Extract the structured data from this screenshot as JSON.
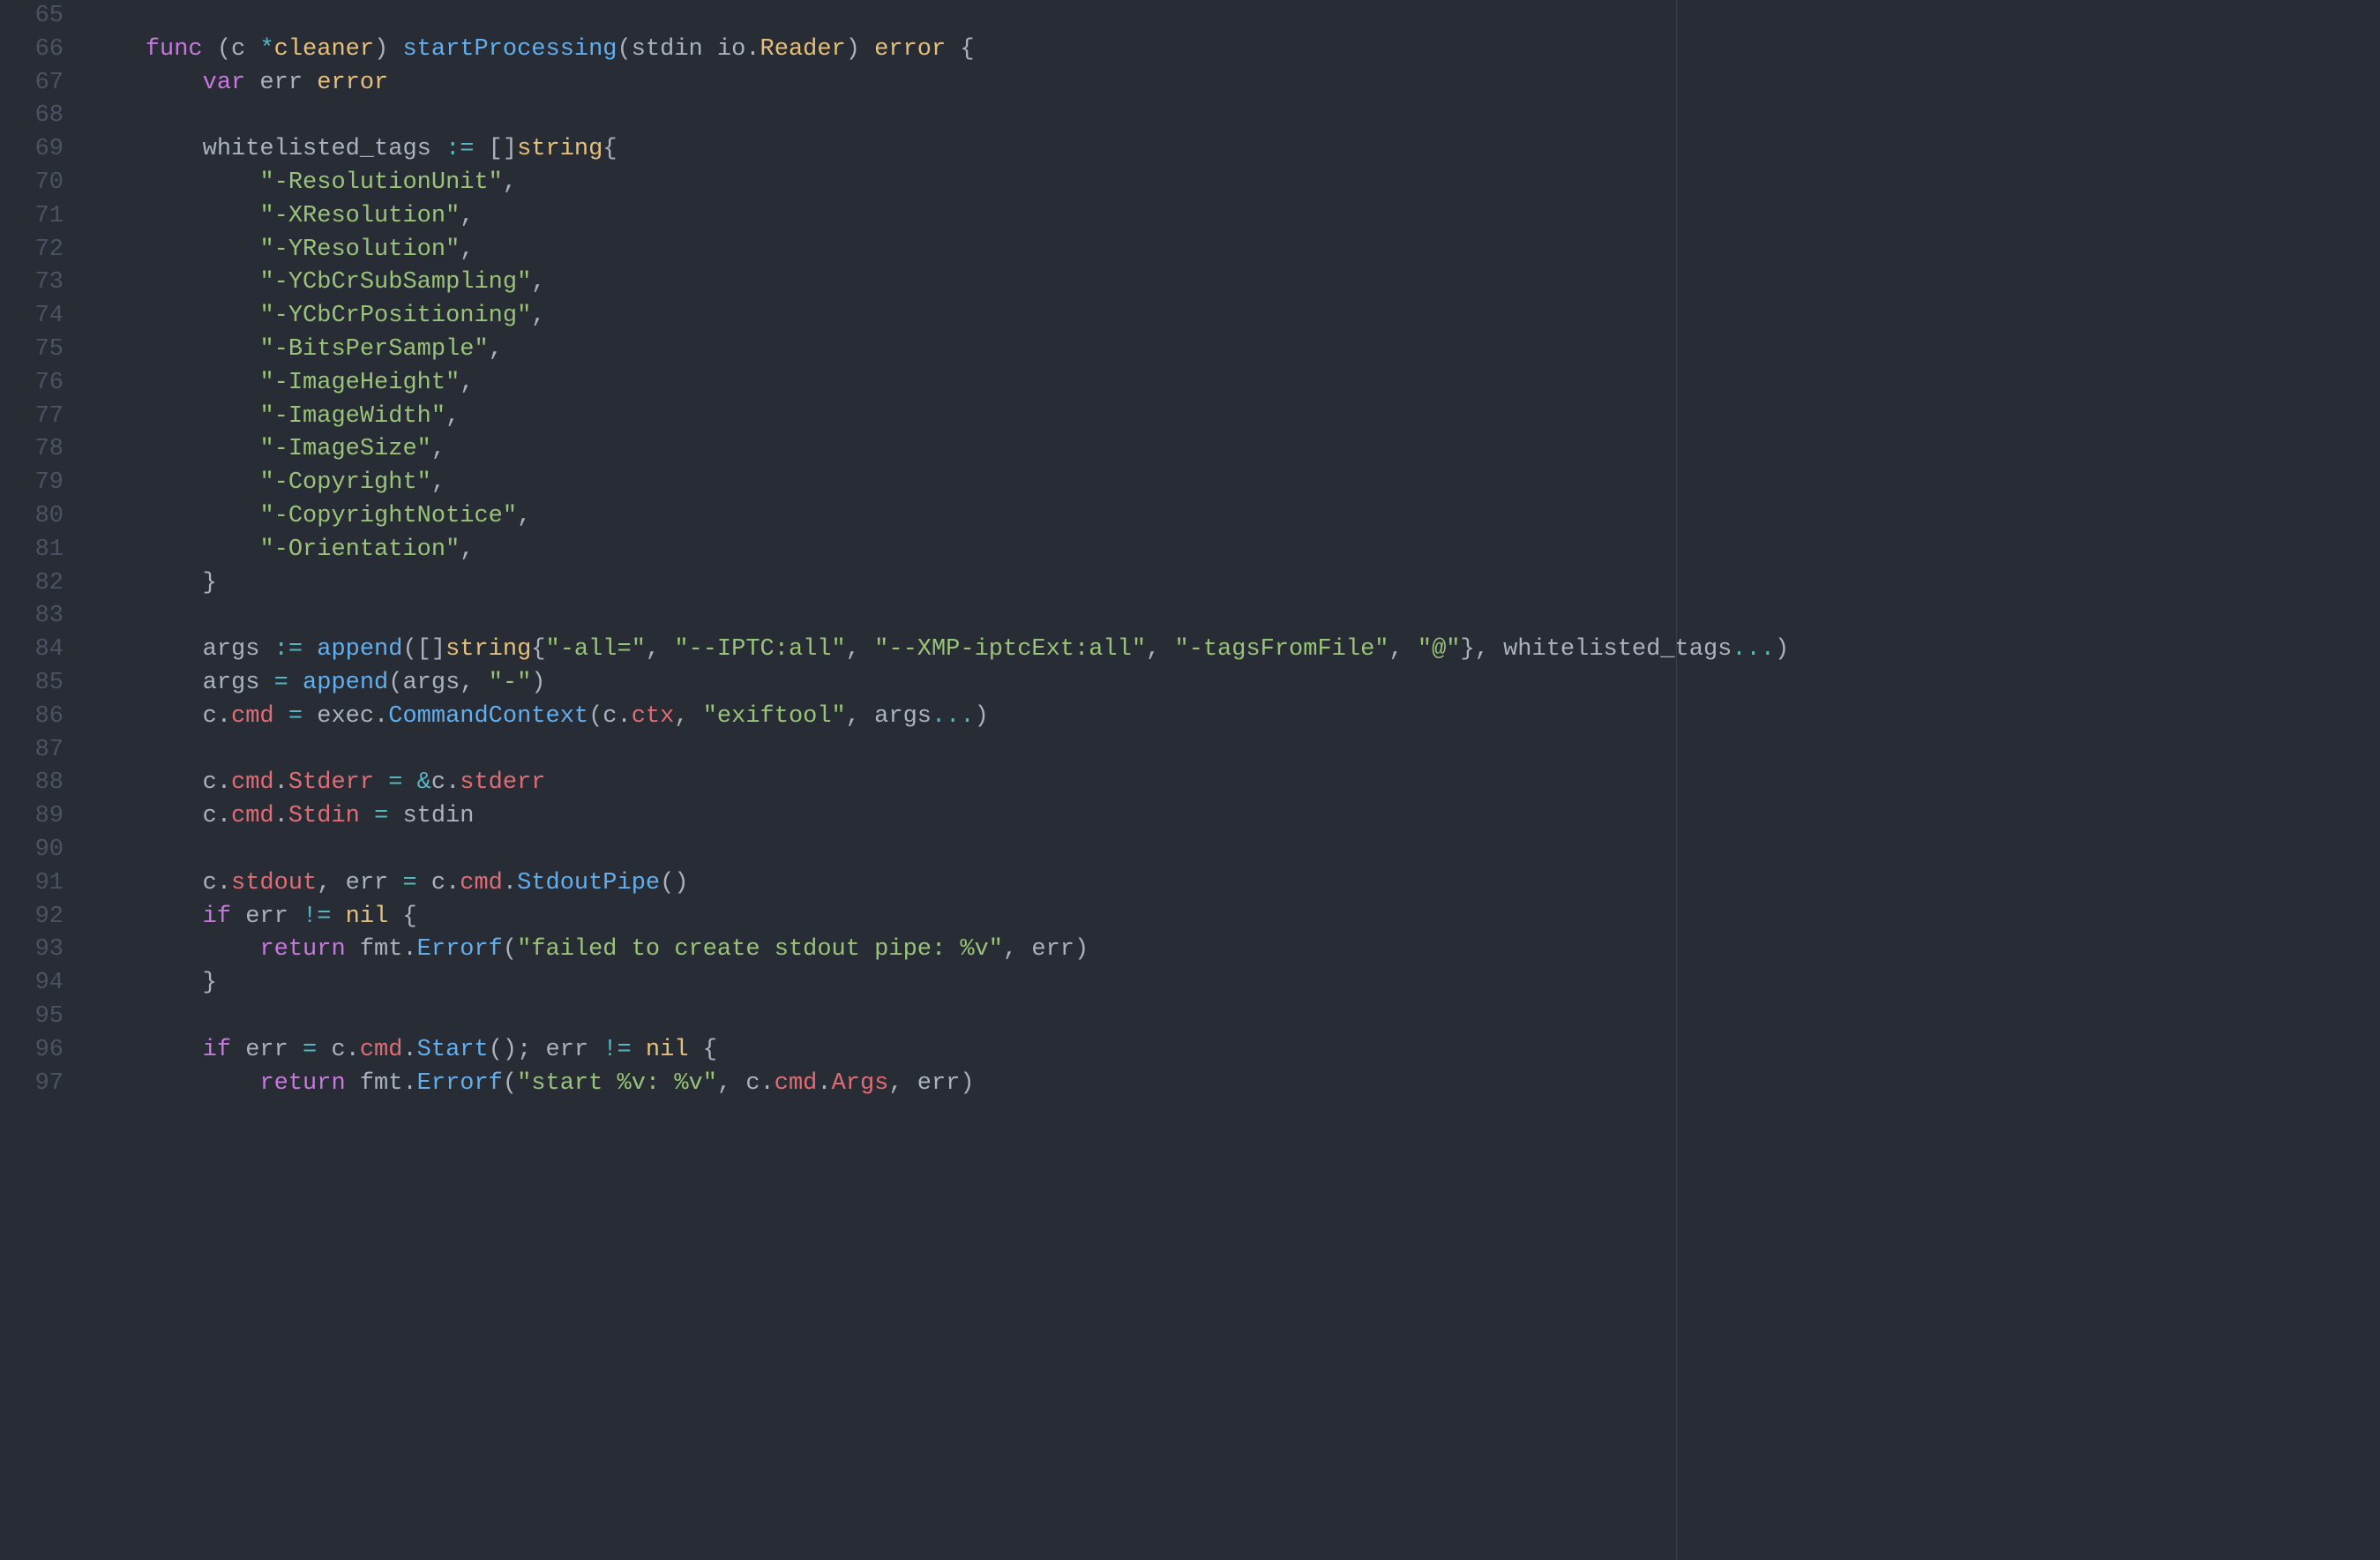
{
  "gutter": {
    "start": 65,
    "end": 97
  },
  "code": {
    "lines": [
      {
        "n": 65,
        "t": []
      },
      {
        "n": 66,
        "t": [
          {
            "c": "ident",
            "s": "    "
          },
          {
            "c": "kw",
            "s": "func"
          },
          {
            "c": "pun",
            "s": " ("
          },
          {
            "c": "ident",
            "s": "c "
          },
          {
            "c": "op",
            "s": "*"
          },
          {
            "c": "recv",
            "s": "cleaner"
          },
          {
            "c": "pun",
            "s": ") "
          },
          {
            "c": "fn",
            "s": "startProcessing"
          },
          {
            "c": "pun",
            "s": "("
          },
          {
            "c": "ident",
            "s": "stdin io"
          },
          {
            "c": "pun",
            "s": "."
          },
          {
            "c": "typ",
            "s": "Reader"
          },
          {
            "c": "pun",
            "s": ") "
          },
          {
            "c": "typ",
            "s": "error"
          },
          {
            "c": "pun",
            "s": " {"
          }
        ]
      },
      {
        "n": 67,
        "t": [
          {
            "c": "ident",
            "s": "        "
          },
          {
            "c": "kw",
            "s": "var"
          },
          {
            "c": "ident",
            "s": " err "
          },
          {
            "c": "typ",
            "s": "error"
          }
        ]
      },
      {
        "n": 68,
        "t": []
      },
      {
        "n": 69,
        "t": [
          {
            "c": "ident",
            "s": "        whitelisted_tags "
          },
          {
            "c": "op",
            "s": ":="
          },
          {
            "c": "pun",
            "s": " []"
          },
          {
            "c": "typ",
            "s": "string"
          },
          {
            "c": "pun",
            "s": "{"
          }
        ]
      },
      {
        "n": 70,
        "t": [
          {
            "c": "ident",
            "s": "            "
          },
          {
            "c": "str",
            "s": "\"-ResolutionUnit\""
          },
          {
            "c": "pun",
            "s": ","
          }
        ]
      },
      {
        "n": 71,
        "t": [
          {
            "c": "ident",
            "s": "            "
          },
          {
            "c": "str",
            "s": "\"-XResolution\""
          },
          {
            "c": "pun",
            "s": ","
          }
        ]
      },
      {
        "n": 72,
        "t": [
          {
            "c": "ident",
            "s": "            "
          },
          {
            "c": "str",
            "s": "\"-YResolution\""
          },
          {
            "c": "pun",
            "s": ","
          }
        ]
      },
      {
        "n": 73,
        "t": [
          {
            "c": "ident",
            "s": "            "
          },
          {
            "c": "str",
            "s": "\"-YCbCrSubSampling\""
          },
          {
            "c": "pun",
            "s": ","
          }
        ]
      },
      {
        "n": 74,
        "t": [
          {
            "c": "ident",
            "s": "            "
          },
          {
            "c": "str",
            "s": "\"-YCbCrPositioning\""
          },
          {
            "c": "pun",
            "s": ","
          }
        ]
      },
      {
        "n": 75,
        "t": [
          {
            "c": "ident",
            "s": "            "
          },
          {
            "c": "str",
            "s": "\"-BitsPerSample\""
          },
          {
            "c": "pun",
            "s": ","
          }
        ]
      },
      {
        "n": 76,
        "t": [
          {
            "c": "ident",
            "s": "            "
          },
          {
            "c": "str",
            "s": "\"-ImageHeight\""
          },
          {
            "c": "pun",
            "s": ","
          }
        ]
      },
      {
        "n": 77,
        "t": [
          {
            "c": "ident",
            "s": "            "
          },
          {
            "c": "str",
            "s": "\"-ImageWidth\""
          },
          {
            "c": "pun",
            "s": ","
          }
        ]
      },
      {
        "n": 78,
        "t": [
          {
            "c": "ident",
            "s": "            "
          },
          {
            "c": "str",
            "s": "\"-ImageSize\""
          },
          {
            "c": "pun",
            "s": ","
          }
        ]
      },
      {
        "n": 79,
        "t": [
          {
            "c": "ident",
            "s": "            "
          },
          {
            "c": "str",
            "s": "\"-Copyright\""
          },
          {
            "c": "pun",
            "s": ","
          }
        ]
      },
      {
        "n": 80,
        "t": [
          {
            "c": "ident",
            "s": "            "
          },
          {
            "c": "str",
            "s": "\"-CopyrightNotice\""
          },
          {
            "c": "pun",
            "s": ","
          }
        ]
      },
      {
        "n": 81,
        "t": [
          {
            "c": "ident",
            "s": "            "
          },
          {
            "c": "str",
            "s": "\"-Orientation\""
          },
          {
            "c": "pun",
            "s": ","
          }
        ]
      },
      {
        "n": 82,
        "t": [
          {
            "c": "ident",
            "s": "        "
          },
          {
            "c": "pun",
            "s": "}"
          }
        ]
      },
      {
        "n": 83,
        "t": []
      },
      {
        "n": 84,
        "t": [
          {
            "c": "ident",
            "s": "        args "
          },
          {
            "c": "op",
            "s": ":="
          },
          {
            "c": "ident",
            "s": " "
          },
          {
            "c": "fn",
            "s": "append"
          },
          {
            "c": "pun",
            "s": "([]"
          },
          {
            "c": "typ",
            "s": "string"
          },
          {
            "c": "pun",
            "s": "{"
          },
          {
            "c": "str",
            "s": "\"-all=\""
          },
          {
            "c": "pun",
            "s": ", "
          },
          {
            "c": "str",
            "s": "\"--IPTC:all\""
          },
          {
            "c": "pun",
            "s": ", "
          },
          {
            "c": "str",
            "s": "\"--XMP-iptcExt:all\""
          },
          {
            "c": "pun",
            "s": ", "
          },
          {
            "c": "str",
            "s": "\"-tagsFromFile\""
          },
          {
            "c": "pun",
            "s": ", "
          },
          {
            "c": "str",
            "s": "\"@\""
          },
          {
            "c": "pun",
            "s": "}, whitelisted_tags"
          },
          {
            "c": "op",
            "s": "..."
          },
          {
            "c": "pun",
            "s": ")"
          }
        ]
      },
      {
        "n": 85,
        "t": [
          {
            "c": "ident",
            "s": "        args "
          },
          {
            "c": "op",
            "s": "="
          },
          {
            "c": "ident",
            "s": " "
          },
          {
            "c": "fn",
            "s": "append"
          },
          {
            "c": "pun",
            "s": "(args, "
          },
          {
            "c": "str",
            "s": "\"-\""
          },
          {
            "c": "pun",
            "s": ")"
          }
        ]
      },
      {
        "n": 86,
        "t": [
          {
            "c": "ident",
            "s": "        c."
          },
          {
            "c": "var",
            "s": "cmd"
          },
          {
            "c": "ident",
            "s": " "
          },
          {
            "c": "op",
            "s": "="
          },
          {
            "c": "ident",
            "s": " exec."
          },
          {
            "c": "fn",
            "s": "CommandContext"
          },
          {
            "c": "pun",
            "s": "(c."
          },
          {
            "c": "var",
            "s": "ctx"
          },
          {
            "c": "pun",
            "s": ", "
          },
          {
            "c": "str",
            "s": "\"exiftool\""
          },
          {
            "c": "pun",
            "s": ", args"
          },
          {
            "c": "op",
            "s": "..."
          },
          {
            "c": "pun",
            "s": ")"
          }
        ]
      },
      {
        "n": 87,
        "t": []
      },
      {
        "n": 88,
        "t": [
          {
            "c": "ident",
            "s": "        c."
          },
          {
            "c": "var",
            "s": "cmd"
          },
          {
            "c": "pun",
            "s": "."
          },
          {
            "c": "var",
            "s": "Stderr"
          },
          {
            "c": "ident",
            "s": " "
          },
          {
            "c": "op",
            "s": "="
          },
          {
            "c": "ident",
            "s": " "
          },
          {
            "c": "op",
            "s": "&"
          },
          {
            "c": "ident",
            "s": "c."
          },
          {
            "c": "var",
            "s": "stderr"
          }
        ]
      },
      {
        "n": 89,
        "t": [
          {
            "c": "ident",
            "s": "        c."
          },
          {
            "c": "var",
            "s": "cmd"
          },
          {
            "c": "pun",
            "s": "."
          },
          {
            "c": "var",
            "s": "Stdin"
          },
          {
            "c": "ident",
            "s": " "
          },
          {
            "c": "op",
            "s": "="
          },
          {
            "c": "ident",
            "s": " stdin"
          }
        ]
      },
      {
        "n": 90,
        "t": []
      },
      {
        "n": 91,
        "t": [
          {
            "c": "ident",
            "s": "        c."
          },
          {
            "c": "var",
            "s": "stdout"
          },
          {
            "c": "pun",
            "s": ", err "
          },
          {
            "c": "op",
            "s": "="
          },
          {
            "c": "ident",
            "s": " c."
          },
          {
            "c": "var",
            "s": "cmd"
          },
          {
            "c": "pun",
            "s": "."
          },
          {
            "c": "fn",
            "s": "StdoutPipe"
          },
          {
            "c": "pun",
            "s": "()"
          }
        ]
      },
      {
        "n": 92,
        "t": [
          {
            "c": "ident",
            "s": "        "
          },
          {
            "c": "kw",
            "s": "if"
          },
          {
            "c": "ident",
            "s": " err "
          },
          {
            "c": "op",
            "s": "!="
          },
          {
            "c": "ident",
            "s": " "
          },
          {
            "c": "typ",
            "s": "nil"
          },
          {
            "c": "pun",
            "s": " {"
          }
        ]
      },
      {
        "n": 93,
        "t": [
          {
            "c": "ident",
            "s": "            "
          },
          {
            "c": "kw",
            "s": "return"
          },
          {
            "c": "ident",
            "s": " fmt."
          },
          {
            "c": "fn",
            "s": "Errorf"
          },
          {
            "c": "pun",
            "s": "("
          },
          {
            "c": "str",
            "s": "\"failed to create stdout pipe: %v\""
          },
          {
            "c": "pun",
            "s": ", err)"
          }
        ]
      },
      {
        "n": 94,
        "t": [
          {
            "c": "ident",
            "s": "        "
          },
          {
            "c": "pun",
            "s": "}"
          }
        ]
      },
      {
        "n": 95,
        "t": []
      },
      {
        "n": 96,
        "t": [
          {
            "c": "ident",
            "s": "        "
          },
          {
            "c": "kw",
            "s": "if"
          },
          {
            "c": "ident",
            "s": " err "
          },
          {
            "c": "op",
            "s": "="
          },
          {
            "c": "ident",
            "s": " c."
          },
          {
            "c": "var",
            "s": "cmd"
          },
          {
            "c": "pun",
            "s": "."
          },
          {
            "c": "fn",
            "s": "Start"
          },
          {
            "c": "pun",
            "s": "(); err "
          },
          {
            "c": "op",
            "s": "!="
          },
          {
            "c": "ident",
            "s": " "
          },
          {
            "c": "typ",
            "s": "nil"
          },
          {
            "c": "pun",
            "s": " {"
          }
        ]
      },
      {
        "n": 97,
        "t": [
          {
            "c": "ident",
            "s": "            "
          },
          {
            "c": "kw",
            "s": "return"
          },
          {
            "c": "ident",
            "s": " fmt."
          },
          {
            "c": "fn",
            "s": "Errorf"
          },
          {
            "c": "pun",
            "s": "("
          },
          {
            "c": "str",
            "s": "\"start %v: %v\""
          },
          {
            "c": "pun",
            "s": ", c."
          },
          {
            "c": "var",
            "s": "cmd"
          },
          {
            "c": "pun",
            "s": "."
          },
          {
            "c": "var",
            "s": "Args"
          },
          {
            "c": "pun",
            "s": ", err)"
          }
        ]
      }
    ]
  }
}
